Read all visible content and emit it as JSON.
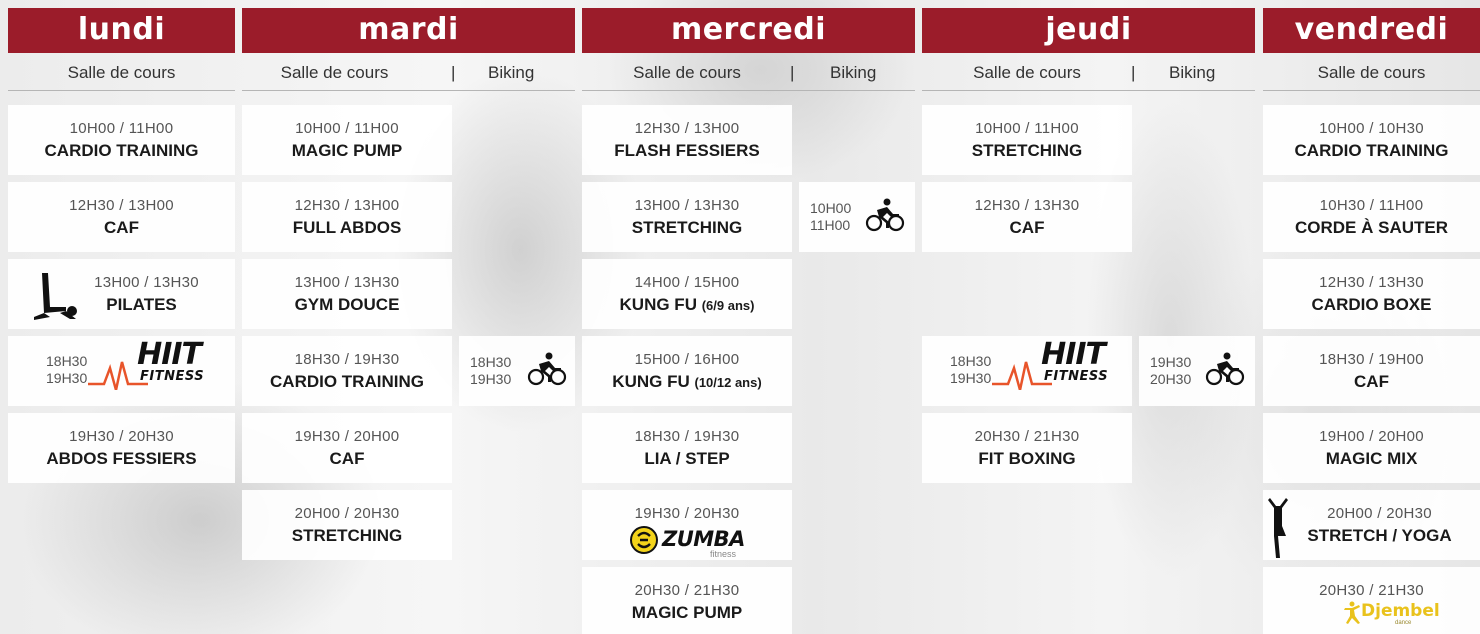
{
  "days": {
    "lundi": {
      "title": "lundi",
      "sub": [
        "Salle de cours"
      ],
      "cards": [
        {
          "time": "10H00 / 11H00",
          "name": "CARDIO TRAINING"
        },
        {
          "time": "12H30 / 13H00",
          "name": "CAF"
        },
        {
          "time": "13H00 / 13H30",
          "name": "PILATES",
          "icon": "pilates-pose-icon"
        },
        {
          "times": [
            "18H30",
            "19H30"
          ],
          "logo": "HIIT FITNESS",
          "logo_word": "HIIT",
          "logo_sub": "FITNESS"
        },
        {
          "time": "19H30 / 20H30",
          "name": "ABDOS FESSIERS"
        }
      ]
    },
    "mardi": {
      "title": "mardi",
      "sub": [
        "Salle de cours",
        "|",
        "Biking"
      ],
      "cards": [
        {
          "time": "10H00 / 11H00",
          "name": "MAGIC PUMP"
        },
        {
          "time": "12H30 / 13H00",
          "name": "FULL ABDOS"
        },
        {
          "time": "13H00 / 13H30",
          "name": "GYM DOUCE"
        },
        {
          "time": "18H30 / 19H30",
          "name": "CARDIO TRAINING"
        },
        {
          "time": "19H30 / 20H00",
          "name": "CAF"
        },
        {
          "time": "20H00 / 20H30",
          "name": "STRETCHING"
        }
      ],
      "biking": [
        {
          "times": [
            "18H30",
            "19H30"
          ],
          "icon": "cyclist-icon"
        }
      ]
    },
    "mercredi": {
      "title": "mercredi",
      "sub": [
        "Salle de cours",
        "|",
        "Biking"
      ],
      "cards": [
        {
          "time": "12H30 / 13H00",
          "name": "FLASH FESSIERS"
        },
        {
          "time": "13H00 / 13H30",
          "name": "STRETCHING"
        },
        {
          "time": "14H00 / 15H00",
          "name": "KUNG FU",
          "small": "(6/9 ans)"
        },
        {
          "time": "15H00 / 16H00",
          "name": "KUNG FU",
          "small": "(10/12 ans)"
        },
        {
          "time": "18H30 / 19H30",
          "name": "LIA / STEP"
        },
        {
          "time": "19H30 / 20H30",
          "logo": "ZUMBA fitness",
          "logo_word": "ZUMBA",
          "logo_sub": "fitness"
        },
        {
          "time": "20H30 / 21H30",
          "name": "MAGIC PUMP"
        }
      ],
      "biking": [
        {
          "times": [
            "10H00",
            "11H00"
          ],
          "icon": "cyclist-icon"
        }
      ]
    },
    "jeudi": {
      "title": "jeudi",
      "sub": [
        "Salle de cours",
        "|",
        "Biking"
      ],
      "cards": [
        {
          "time": "10H00 / 11H00",
          "name": "STRETCHING"
        },
        {
          "time": "12H30 / 13H30",
          "name": "CAF"
        },
        {
          "times": [
            "18H30",
            "19H30"
          ],
          "logo": "HIIT FITNESS",
          "logo_word": "HIIT",
          "logo_sub": "FITNESS"
        },
        {
          "time": "20H30 / 21H30",
          "name": "FIT BOXING"
        }
      ],
      "biking": [
        {
          "times": [
            "19H30",
            "20H30"
          ],
          "icon": "cyclist-icon"
        }
      ]
    },
    "vendredi": {
      "title": "vendredi",
      "sub": [
        "Salle de cours"
      ],
      "cards": [
        {
          "time": "10H00 / 10H30",
          "name": "CARDIO TRAINING"
        },
        {
          "time": "10H30 / 11H00",
          "name": "CORDE À SAUTER"
        },
        {
          "time": "12H30 / 13H30",
          "name": "CARDIO BOXE"
        },
        {
          "time": "18H30 / 19H00",
          "name": "CAF"
        },
        {
          "time": "19H00 / 20H00",
          "name": "MAGIC MIX"
        },
        {
          "time": "20H00 / 20H30",
          "name": "STRETCH / YOGA",
          "icon": "yoga-pose-icon"
        },
        {
          "time": "20H30 / 21H30",
          "logo": "Djembel dance",
          "logo_word": "Djembel",
          "logo_sub": "dance"
        }
      ]
    }
  },
  "colors": {
    "header_bg": "#9b1c2a",
    "hiit_accent": "#e8542a",
    "zumba_yellow": "#f3d31a",
    "djembel_yellow": "#e9c21c"
  }
}
